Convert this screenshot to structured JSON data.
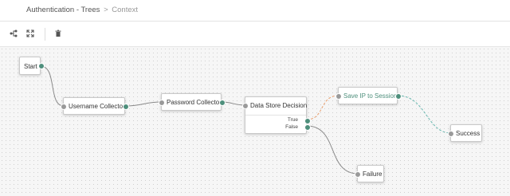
{
  "breadcrumb": {
    "section": "Authentication - Trees",
    "separator": ">",
    "current": "Context"
  },
  "toolbar": {
    "layout_icon": "tree-layout-icon",
    "fullscreen_icon": "expand-icon",
    "delete_icon": "trash-icon"
  },
  "colors": {
    "port_out": "#4e8f7c",
    "port_in": "#9a9a9a",
    "link_default": "#8a8a8a",
    "link_true": "#e8a070",
    "link_success": "#6bb8b0",
    "highlight_text": "#4e8f7c"
  },
  "nodes": {
    "start": {
      "label": "Start"
    },
    "username_collector": {
      "label": "Username Collector"
    },
    "password_collector": {
      "label": "Password Collector"
    },
    "data_store_decision": {
      "label": "Data Store Decision",
      "outcome_true": "True",
      "outcome_false": "False"
    },
    "save_ip": {
      "label": "Save IP to Session"
    },
    "success": {
      "label": "Success"
    },
    "failure": {
      "label": "Failure"
    }
  }
}
